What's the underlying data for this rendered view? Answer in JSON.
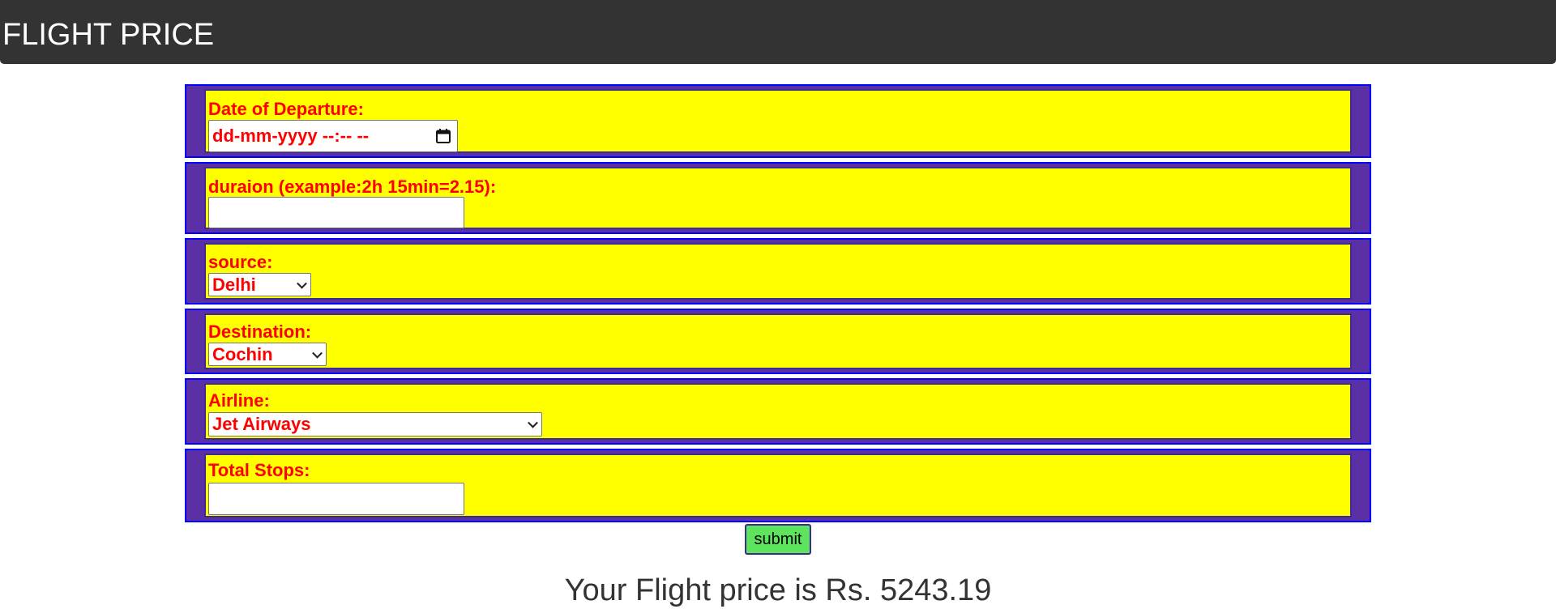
{
  "header": {
    "title": "FLIGHT PRICE"
  },
  "form": {
    "departure": {
      "label": "Date of Departure:",
      "value": "dd-mm-yyyy --:-- --",
      "icon": "calendar-icon"
    },
    "duration": {
      "label": "duraion (example:2h 15min=2.15):",
      "value": ""
    },
    "source": {
      "label": "source:",
      "selected": "Delhi"
    },
    "destination": {
      "label": "Destination:",
      "selected": "Cochin"
    },
    "airline": {
      "label": "Airline:",
      "selected": "Jet Airways"
    },
    "total_stops": {
      "label": "Total Stops:",
      "value": ""
    },
    "submit_label": "submit"
  },
  "result": {
    "text": "Your Flight price is Rs. 5243.19"
  },
  "colors": {
    "navbar": "#333333",
    "row_border": "#0000ff",
    "row_bg": "#5b2fa5",
    "inner_bg": "#ffff00",
    "label": "#ff0000",
    "submit_bg": "#5ee35e"
  }
}
